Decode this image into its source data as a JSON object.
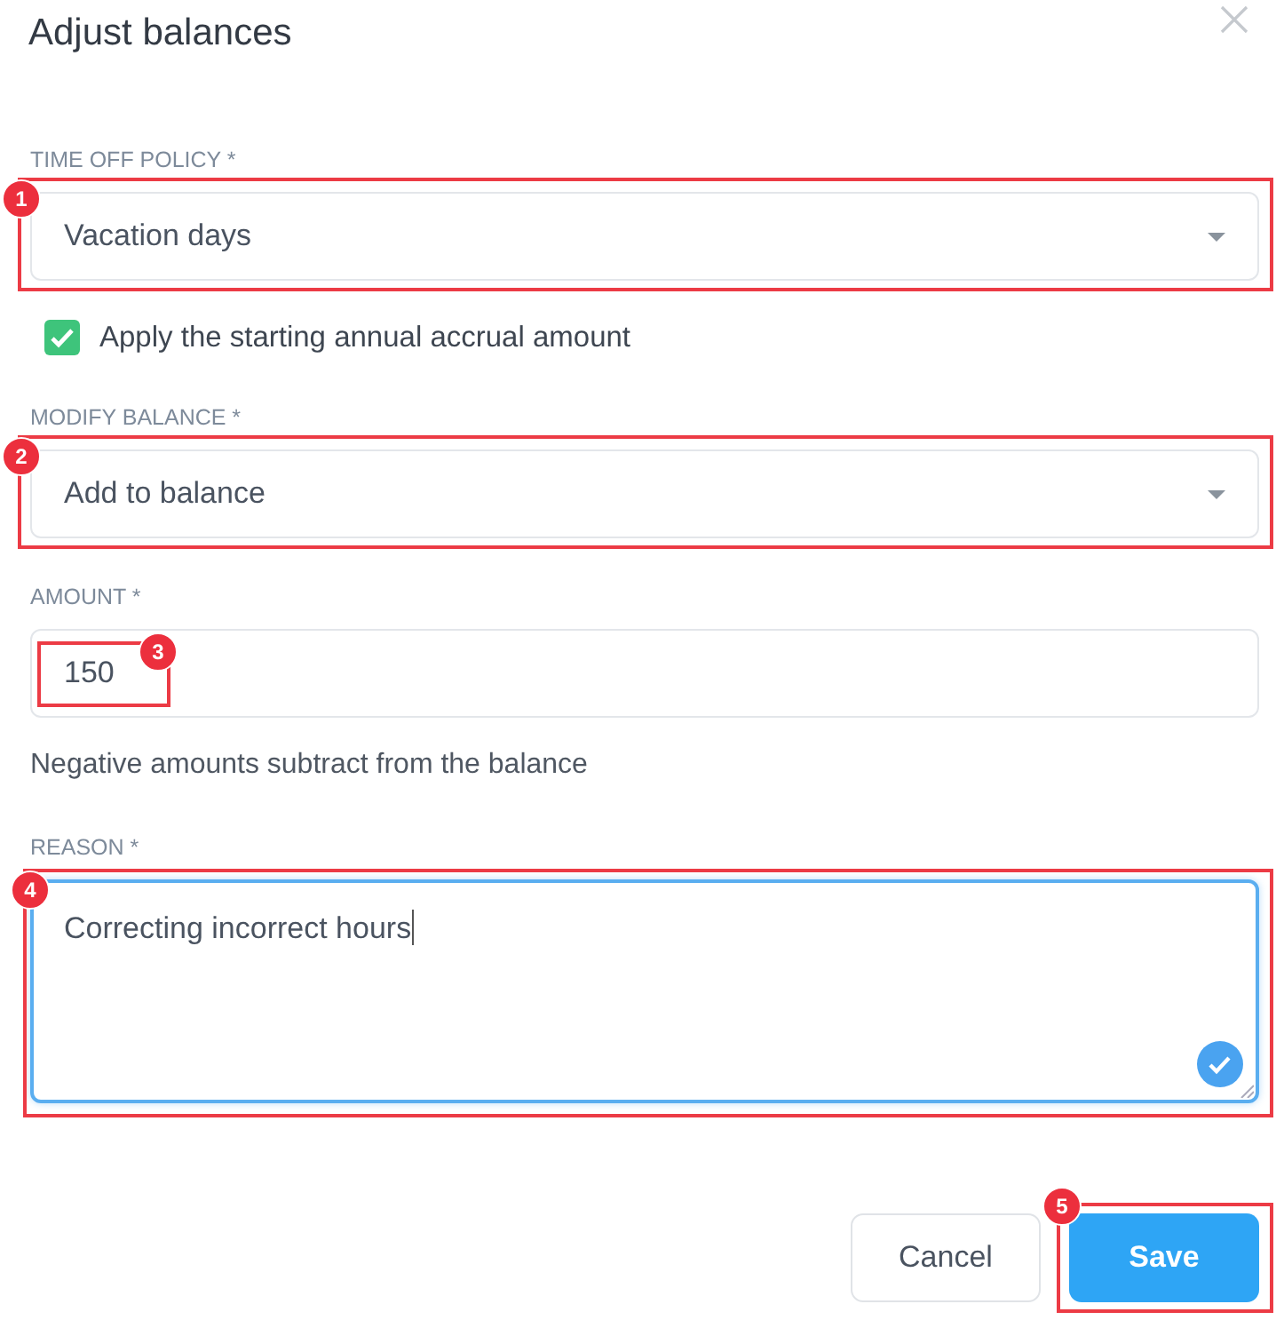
{
  "dialog": {
    "title": "Adjust balances",
    "fields": [
      {
        "kind": "select",
        "label": "TIME OFF POLICY *",
        "value": "Vacation days",
        "callout": "1"
      },
      {
        "kind": "checkbox",
        "label": "Apply the starting annual accrual amount",
        "checked": true
      },
      {
        "kind": "select",
        "label": "MODIFY BALANCE *",
        "value": "Add to balance",
        "callout": "2"
      },
      {
        "kind": "input",
        "label": "AMOUNT *",
        "value": "150",
        "callout": "3",
        "help": "Negative amounts subtract from the balance"
      },
      {
        "kind": "textarea",
        "label": "REASON *",
        "value": "Correcting incorrect hours",
        "focused": true,
        "valid": true,
        "callout": "4"
      }
    ],
    "buttons": [
      {
        "label": "Cancel",
        "kind": "secondary"
      },
      {
        "label": "Save",
        "kind": "primary",
        "callout": "5"
      }
    ]
  }
}
